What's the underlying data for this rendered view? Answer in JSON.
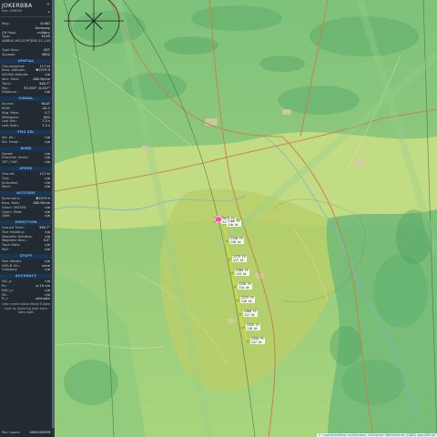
{
  "sidebar": {
    "title": "JOKERBBA",
    "subtitle": "Hex: 3F6D99",
    "close_symbol": "×",
    "info_rows": [
      {
        "k": "Reg.:",
        "v": "D-HJD"
      },
      {
        "k": "",
        "v": "Germany"
      },
      {
        "k": "DB flags:",
        "v": "military"
      },
      {
        "k": "Type:",
        "v": "EC45"
      },
      {
        "k": "AIRBUS HELICOPTERS EC-145",
        "v": ""
      }
    ],
    "info_rows2": [
      {
        "k": "Type Desc.:",
        "v": "H2T"
      },
      {
        "k": "Squawk:",
        "v": "4652"
      }
    ],
    "sections": [
      {
        "title": "SPATIAL",
        "rows": [
          {
            "k": "Groundspeed:",
            "v": "117 kt"
          },
          {
            "k": "Baro. Altitude:",
            "v": "▼1975 ft"
          },
          {
            "k": "WGS84 altitude:",
            "v": "n/a"
          },
          {
            "k": "Vert. Rate:",
            "v": "-384 ft/min"
          },
          {
            "k": "Track:",
            "v": "348.7°"
          },
          {
            "k": "Pos.:",
            "v": "50.354°, 6.457°"
          },
          {
            "k": "Distance:",
            "v": "n/a"
          }
        ]
      },
      {
        "title": "SIGNAL",
        "rows": [
          {
            "k": "Source:",
            "v": "MLAT"
          },
          {
            "k": "RSSI:",
            "v": "-20.1"
          },
          {
            "k": "Msg. Rate:",
            "v": "0.7"
          },
          {
            "k": "Messages:",
            "v": "841"
          },
          {
            "k": "Last Pos.:",
            "v": "7.2 s"
          },
          {
            "k": "Last Seen:",
            "v": "7.2 s"
          }
        ]
      },
      {
        "title": "FMS SEL",
        "rows": [
          {
            "k": "Sel. Alt.:",
            "v": "n/a"
          },
          {
            "k": "Sel. Head.:",
            "v": "n/a"
          }
        ]
      },
      {
        "title": "WIND",
        "rows": [
          {
            "k": "Speed:",
            "v": "n/a"
          },
          {
            "k": "Direction (from):",
            "v": "n/a"
          },
          {
            "k": "TAT / OAT:",
            "v": "n/a"
          }
        ]
      },
      {
        "title": "SPEED",
        "rows": [
          {
            "k": "Ground:",
            "v": "117 kt"
          },
          {
            "k": "True:",
            "v": "n/a"
          },
          {
            "k": "Indicated:",
            "v": "n/a"
          },
          {
            "k": "Mach:",
            "v": "n/a"
          }
        ]
      },
      {
        "title": "ALTITUDE",
        "rows": [
          {
            "k": "Barometric:",
            "v": "▼1975 ft"
          },
          {
            "k": "Baro. Rate:",
            "v": "-384 ft/min"
          },
          {
            "k": "Geom. WGS84:",
            "v": "n/a"
          },
          {
            "k": "Geom. Rate:",
            "v": "n/a"
          },
          {
            "k": "QNH:",
            "v": "n/a"
          }
        ]
      },
      {
        "title": "DIRECTION",
        "rows": [
          {
            "k": "Ground Track:",
            "v": "348.7°"
          },
          {
            "k": "True Heading:",
            "v": "n/a"
          },
          {
            "k": "Magnetic Heading:",
            "v": "n/a"
          },
          {
            "k": "Magnetic Decl.:",
            "v": "3.4°"
          },
          {
            "k": "Track Rate:",
            "v": "n/a"
          },
          {
            "k": "Roll:",
            "v": "n/a"
          }
        ]
      },
      {
        "title": "STUFF",
        "rows": [
          {
            "k": "Nav. Modes:",
            "v": "n/a"
          },
          {
            "k": "ADS-B Ver.:",
            "v": "none"
          },
          {
            "k": "Category:",
            "v": "n/a"
          }
        ]
      },
      {
        "title": "ACCURACY",
        "rows": [
          {
            "k": "NIC_p:",
            "v": "n/a"
          },
          {
            "k": "Rc:",
            "v": "≥ 10 nm"
          },
          {
            "k": "NAC_p:",
            "v": "n/a"
          },
          {
            "k": "SIL:",
            "v": "n/a"
          },
          {
            "k": "R_c:",
            "v": "unknown"
          }
        ]
      }
    ],
    "note": "Learn more about Mode S data type by hovering over each data label",
    "footer": {
      "k": "Pos. epoch:",
      "v": "1661290399"
    }
  },
  "map": {
    "aircraft_icon": "helicopter-icon",
    "compass_icon": "range-ring-icon",
    "colors": {
      "trail": "#e0e020",
      "aircraft": "#ff40c0",
      "lowland": "#b9d97a",
      "upland": "#7cc17a"
    },
    "track_points": [
      {
        "alt": "2075 ft",
        "speed": "117 kt"
      },
      {
        "alt": "2100 ft",
        "speed": "116 kt"
      },
      {
        "alt": "2150 ft",
        "speed": "118 kt"
      },
      {
        "alt": "2175 ft",
        "speed": "117 kt"
      },
      {
        "alt": "2200 ft",
        "speed": "115 kt"
      },
      {
        "alt": "2250 ft",
        "speed": "114 kt"
      },
      {
        "alt": "2275 ft",
        "speed": "116 kt"
      },
      {
        "alt": "2300 ft",
        "speed": "117 kt"
      },
      {
        "alt": "2325 ft",
        "speed": "118 kt"
      },
      {
        "alt": "2350 ft",
        "speed": "117 kt"
      }
    ],
    "attribution": {
      "text": "© OpenStreetMap contributors, Deutscher Wetterdienst (DWD) openAIP.net"
    }
  }
}
